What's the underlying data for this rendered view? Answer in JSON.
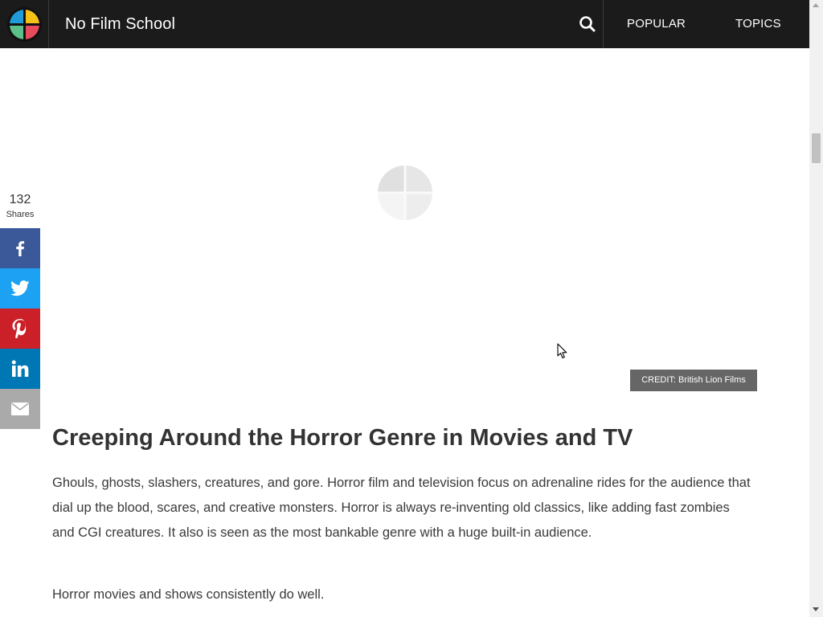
{
  "header": {
    "brand": "No Film School",
    "nav": [
      "POPULAR",
      "TOPICS"
    ],
    "icons": {
      "logo": "nfs-logo-icon",
      "search": "search-icon"
    }
  },
  "media": {
    "credit": "CREDIT: British Lion Films",
    "loader_icon": "loading-spinner-icon"
  },
  "share": {
    "count": "132",
    "label": "Shares",
    "buttons": [
      "facebook-icon",
      "twitter-icon",
      "pinterest-icon",
      "linkedin-icon",
      "email-icon"
    ],
    "colors": {
      "facebook": "#3b5998",
      "twitter": "#1da1f2",
      "pinterest": "#cb2027",
      "linkedin": "#0077b5",
      "email": "#aaaaaa"
    }
  },
  "article": {
    "title": "Creeping Around the Horror Genre in Movies and TV",
    "paragraphs": [
      "Ghouls, ghosts, slashers, creatures, and gore. Horror film and television focus on adrenaline rides for the audience that dial up the blood, scares, and creative monsters. Horror is always re-inventing old classics, like adding fast zombies and CGI creatures. It also is seen as the most bankable genre with a huge built-in audience.",
      "Horror movies and shows consistently do well."
    ]
  },
  "colors": {
    "topbar": "#1b1b1b",
    "text": "#333333"
  }
}
